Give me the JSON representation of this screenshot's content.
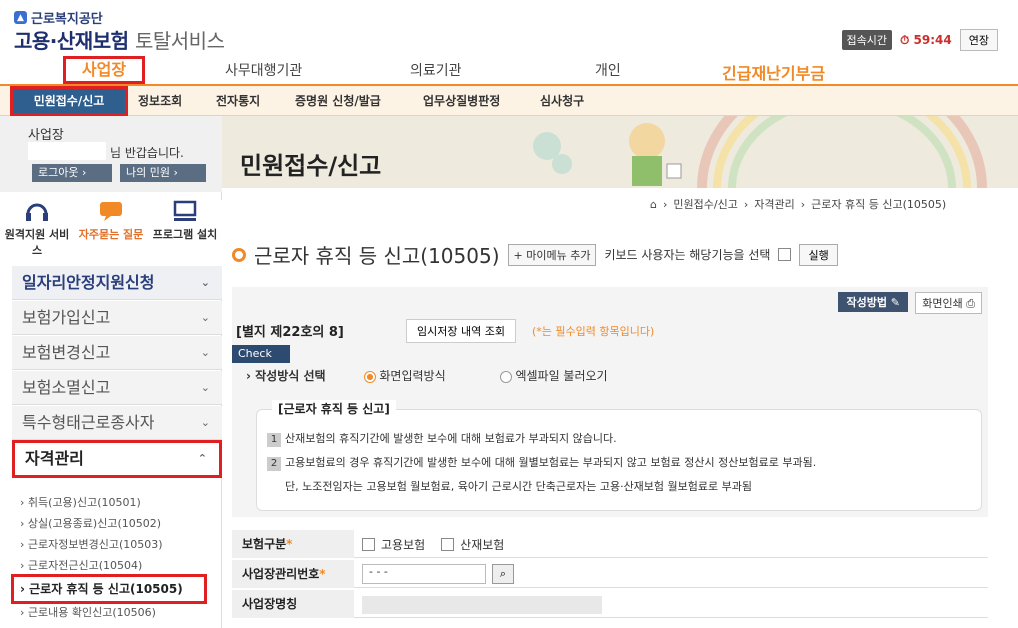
{
  "header": {
    "org": "근로복지공단",
    "title_main": "고용·산재보험",
    "title_sub": "토탈서비스",
    "session_label": "접속시간",
    "timer": "59:44",
    "extend": "연장"
  },
  "categories": [
    "사업장",
    "사무대행기관",
    "의료기관",
    "개인",
    "긴급재난기부금"
  ],
  "main_menu": [
    "민원접수/신고",
    "정보조회",
    "전자통지",
    "증명원 신청/발급",
    "업무상질병판정",
    "심사청구"
  ],
  "user": {
    "org": "사업장",
    "greeting": "님 반갑습니다.",
    "logout": "로그아웃",
    "my_civil": "나의 민원"
  },
  "quick": [
    "원격지원 서비스",
    "자주묻는 질문",
    "프로그램 설치"
  ],
  "accordion": [
    "일자리안정지원신청",
    "보험가입신고",
    "보험변경신고",
    "보험소멸신고",
    "특수형태근로종사자",
    "자격관리"
  ],
  "sub_items": [
    "취득(고용)신고(10501)",
    "상실(고용종료)신고(10502)",
    "근로자정보변경신고(10503)",
    "근로자전근신고(10504)",
    "근로자 휴직 등 신고(10505)",
    "근로내용 확인신고(10506)"
  ],
  "banner_title": "민원접수/신고",
  "breadcrumb": [
    "민원접수/신고",
    "자격관리",
    "근로자 휴직 등 신고(10505)"
  ],
  "page": {
    "heading": "근로자 휴직 등 신고(10505)",
    "mymenu": "+ 마이메뉴 추가",
    "kb_text": "키보드 사용자는 해당기능을 선택",
    "run": "실행"
  },
  "form": {
    "write_method": "작성방법",
    "print": "화면인쇄",
    "form_no": "[별지 제22호의 8]",
    "temp_btn": "임시저장 내역 조회",
    "req_note": "(*는 필수입력 항목입니다)",
    "check": "Check",
    "method_label": "작성방식 선택",
    "opt1": "화면입력방식",
    "opt2": "엑셀파일 불러오기"
  },
  "notice": {
    "title": "[근로자 휴직 등 신고]",
    "line1": "산재보험의 휴직기간에 발생한 보수에 대해 보험료가 부과되지 않습니다.",
    "line2": "고용보험료의 경우 휴직기간에 발생한 보수에 대해 월별보험료는 부과되지 않고 보험료 정산시 정산보험료로 부과됨.",
    "line3": "단, 노조전임자는 고용보험 월보험료, 육아기 근로시간 단축근로자는 고용·산재보험 월보험료로 부과됨"
  },
  "fields": {
    "ins_type": "보험구분",
    "employment": "고용보험",
    "industrial": "산재보험",
    "bizno": "사업장관리번호",
    "bizno_value": "- -  -",
    "bizname": "사업장명칭"
  },
  "colors": {
    "accent": "#f18a26",
    "navy": "#2f5f8e",
    "highlight": "#e02020"
  }
}
